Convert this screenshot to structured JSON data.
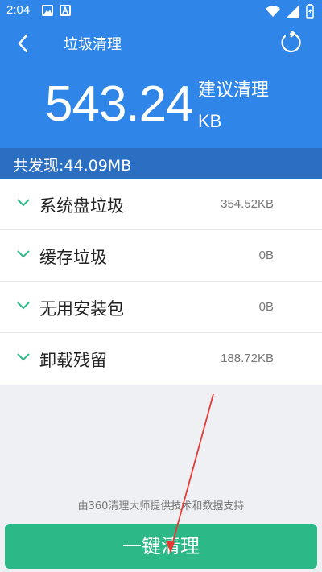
{
  "status_bar": {
    "time": "2:04",
    "icons": [
      "image-icon",
      "a-badge-icon",
      "wifi-icon",
      "signal-icon",
      "battery-icon"
    ]
  },
  "header": {
    "title": "垃圾清理",
    "back_icon": "back-arrow-icon",
    "refresh_icon": "refresh-icon"
  },
  "summary": {
    "size_value": "543.24",
    "size_unit": "KB",
    "suggest_label": "建议清理",
    "found_text": "共发现:44.09MB"
  },
  "categories": [
    {
      "label": "系统盘垃圾",
      "size": "354.52KB"
    },
    {
      "label": "缓存垃圾",
      "size": "0B"
    },
    {
      "label": "无用安装包",
      "size": "0B"
    },
    {
      "label": "卸载残留",
      "size": "188.72KB"
    }
  ],
  "footer": {
    "powered_by": "由360清理大师提供技术和数据支持",
    "clean_button": "一键清理"
  },
  "colors": {
    "header_blue": "#2f86e8",
    "found_bar_blue": "#2b6fc2",
    "accent_green": "#2db887",
    "annotation_red": "#e53935"
  }
}
